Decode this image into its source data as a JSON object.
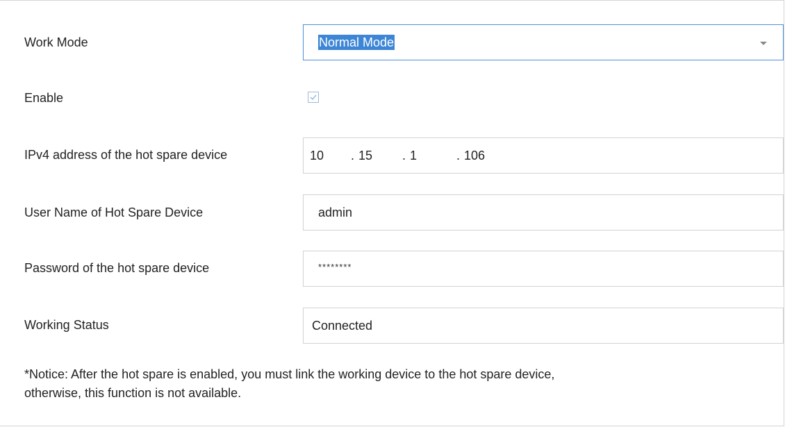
{
  "form": {
    "work_mode": {
      "label": "Work Mode",
      "value": "Normal Mode",
      "icon": "chevron-down-icon"
    },
    "enable": {
      "label": "Enable",
      "checked": true
    },
    "ipv4": {
      "label": "IPv4 address of the hot spare device",
      "octets": [
        "10",
        "15",
        "1",
        "106"
      ],
      "separator": "."
    },
    "user_name": {
      "label": "User Name of Hot Spare Device",
      "value": "admin"
    },
    "password": {
      "label": "Password of the hot spare device",
      "value": "********"
    },
    "working_status": {
      "label": "Working Status",
      "value": "Connected"
    },
    "notice_line1": "*Notice: After the hot spare is enabled, you must link the working device to the hot spare device,",
    "notice_line2": "otherwise, this function is not available."
  },
  "colors": {
    "accent": "#3d86d6",
    "field_border": "#d2d2d2",
    "text": "#222222"
  }
}
